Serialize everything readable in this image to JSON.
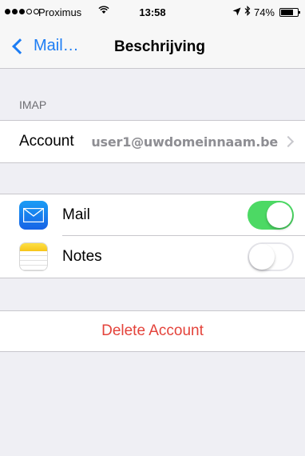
{
  "status_bar": {
    "carrier": "Proximus",
    "time": "13:58",
    "battery_percent": "74%",
    "battery_level": 0.74,
    "signal_dots": [
      true,
      true,
      true,
      false,
      false
    ],
    "wifi_icon": "wifi-icon",
    "location_icon": "location-arrow-icon",
    "bluetooth_icon": "bluetooth-icon"
  },
  "nav": {
    "back_label": "Mail…",
    "title": "Beschrijving"
  },
  "sections": {
    "imap_header": "IMAP"
  },
  "account": {
    "label": "Account",
    "value": "user1@uwdomeinnaam.be"
  },
  "services": [
    {
      "label": "Mail",
      "icon": "mail-icon",
      "enabled": true
    },
    {
      "label": "Notes",
      "icon": "notes-icon",
      "enabled": false
    }
  ],
  "actions": {
    "delete_label": "Delete Account"
  },
  "colors": {
    "accent": "#1d7df4",
    "toggle_on": "#4cd964",
    "destructive": "#e4433b",
    "background": "#efeff4"
  }
}
